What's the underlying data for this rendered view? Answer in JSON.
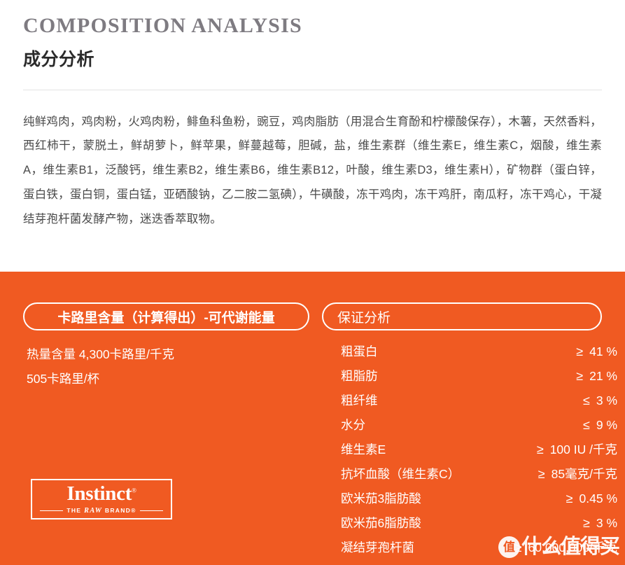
{
  "header": {
    "title_en": "COMPOSITION ANALYSIS",
    "title_cn": "成分分析"
  },
  "ingredients": {
    "text": "纯鲜鸡肉，鸡肉粉，火鸡肉粉，鲱鱼科鱼粉，豌豆，鸡肉脂肪（用混合生育酚和柠檬酸保存），木薯，天然香料，西红柿干，蒙脱土，鲜胡萝卜，鲜苹果，鲜蔓越莓，胆碱，盐，维生素群（维生素E，维生素C，烟酸，维生素A，维生素B1，泛酸钙，维生素B2，维生素B6，维生素B12，叶酸，维生素D3，维生素H），矿物群（蛋白锌，蛋白铁，蛋白铜，蛋白锰，亚硒酸钠，乙二胺二氢碘），牛磺酸，冻干鸡肉，冻干鸡肝，南瓜籽，冻干鸡心，干凝结芽孢杆菌发酵产物，迷迭香萃取物。"
  },
  "calories": {
    "pill_label": "卡路里含量（计算得出）-可代谢能量",
    "lines": [
      "热量含量 4,300卡路里/千克",
      "505卡路里/杯"
    ]
  },
  "guaranteed": {
    "pill_label": "保证分析",
    "rows": [
      {
        "label": "粗蛋白",
        "op": "≥",
        "value": "41 %"
      },
      {
        "label": "粗脂肪",
        "op": "≥",
        "value": "21 %"
      },
      {
        "label": "粗纤维",
        "op": "≤",
        "value": "3 %"
      },
      {
        "label": "水分",
        "op": "≤",
        "value": "9 %"
      },
      {
        "label": "维生素E",
        "op": "≥",
        "value": "100 IU /千克"
      },
      {
        "label": "抗坏血酸（维生素C）",
        "op": "≥",
        "value": "85毫克/千克"
      },
      {
        "label": "欧米茄3脂肪酸",
        "op": "≥",
        "value": "0.45 %"
      },
      {
        "label": "欧米茄6脂肪酸",
        "op": "≥",
        "value": "3 %"
      },
      {
        "label": "凝结芽孢杆菌",
        "op": "≥",
        "value": "60,000,000/千克"
      }
    ]
  },
  "logo": {
    "name": "Instinct",
    "registered": "®",
    "tagline_pre": "THE ",
    "tagline_italic": "RAW",
    "tagline_post": " BRAND®"
  },
  "watermark": {
    "badge": "值",
    "text": "什么值得买"
  },
  "colors": {
    "orange": "#f05a22",
    "title_gray": "#7e7b81",
    "body_gray": "#4a4a4a",
    "white": "#ffffff"
  }
}
